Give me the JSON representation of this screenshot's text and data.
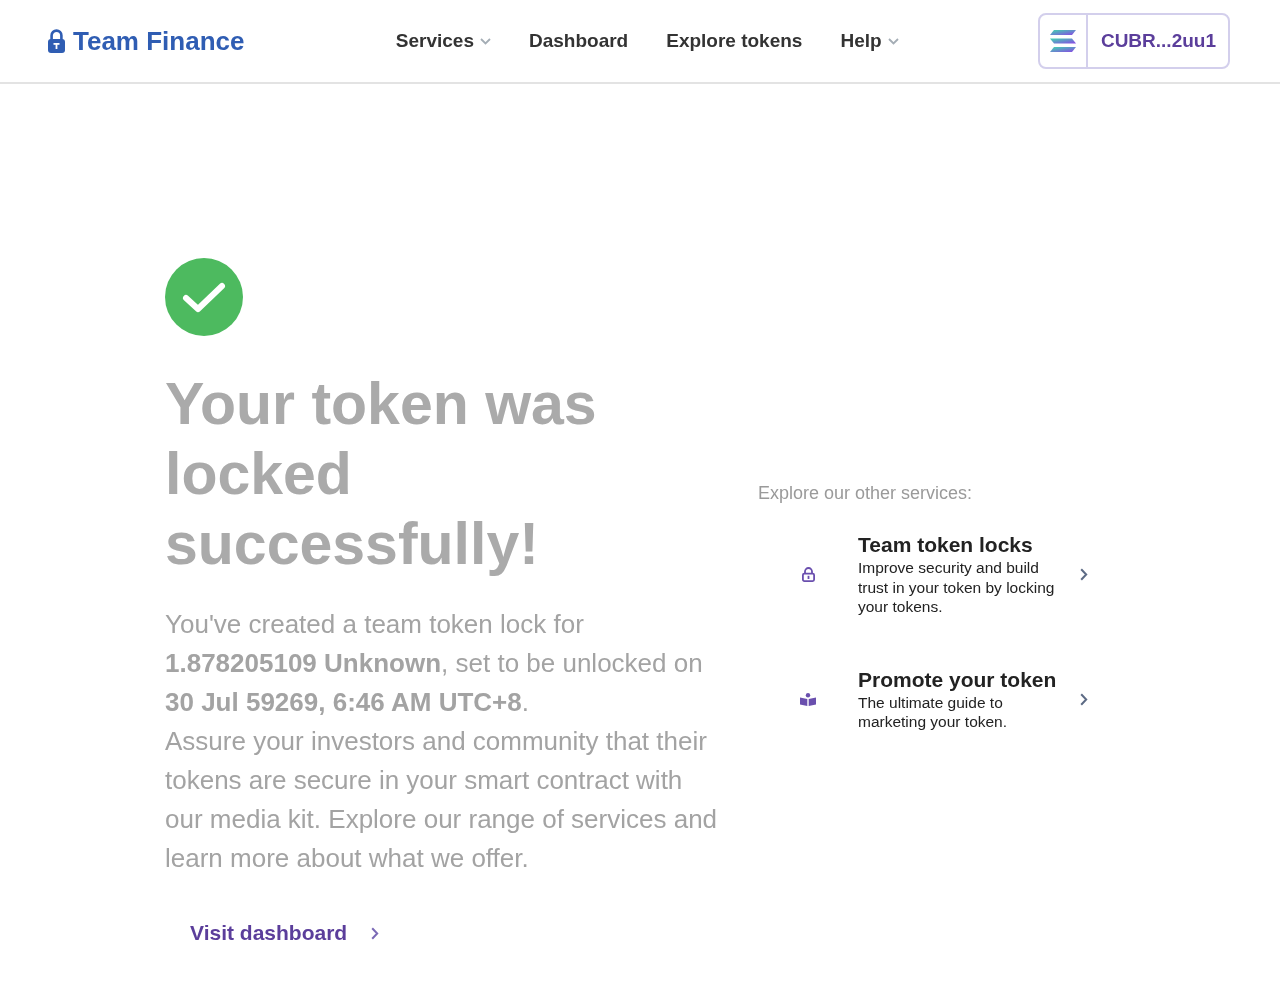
{
  "header": {
    "logo": {
      "text": "Team Finance"
    },
    "nav": [
      {
        "label": "Services",
        "dropdown": true
      },
      {
        "label": "Dashboard",
        "dropdown": false
      },
      {
        "label": "Explore tokens",
        "dropdown": false
      },
      {
        "label": "Help",
        "dropdown": true
      }
    ],
    "wallet": {
      "address": "CUBR...2uu1"
    }
  },
  "result": {
    "success": true,
    "title": "Your token was locked successfully!",
    "paragraphs": [
      "You've created a team token lock for **1.878205109 Unknown**, set to be unlocked on **30 Jul 59269, 6:46 AM UTC+8**.",
      "Assure your investors and community that their tokens are secure in your smart contract with our media kit. Explore our range of services and learn more about what we offer."
    ],
    "link": "Visit dashboard"
  },
  "services": {
    "heading": "Explore our other services:",
    "items": [
      {
        "kind": "lock",
        "title": "Team token locks",
        "description": "Improve security and build trust in your token by locking your tokens."
      },
      {
        "kind": "guide",
        "title": "Promote your token",
        "description": "The ultimate guide to marketing your token."
      }
    ]
  }
}
